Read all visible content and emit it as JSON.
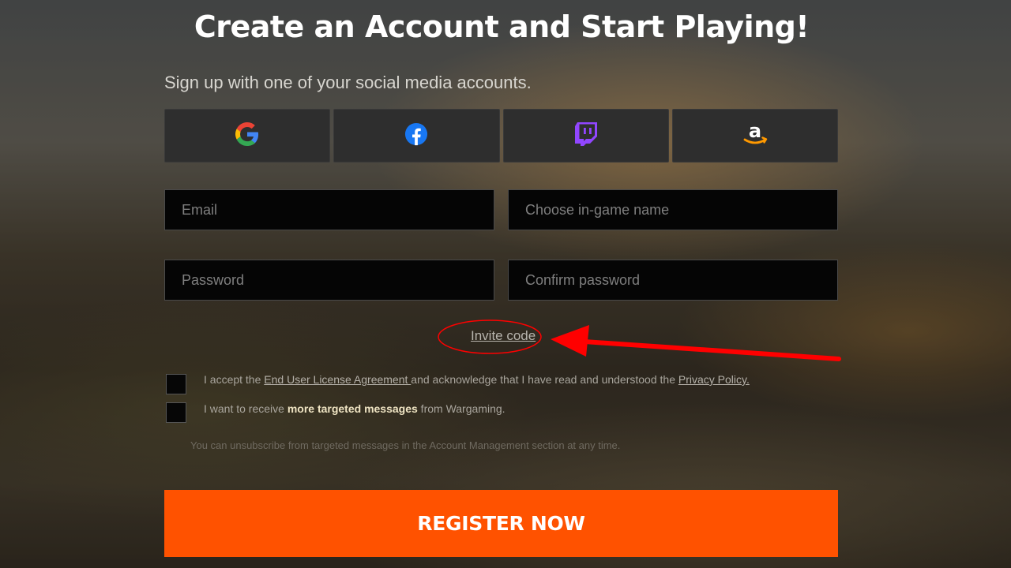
{
  "header": {
    "title": "Create an Account and Start Playing!",
    "subtitle": "Sign up with one of your social media accounts."
  },
  "social": [
    {
      "name": "google",
      "icon": "google-icon"
    },
    {
      "name": "facebook",
      "icon": "facebook-icon"
    },
    {
      "name": "twitch",
      "icon": "twitch-icon"
    },
    {
      "name": "amazon",
      "icon": "amazon-icon"
    }
  ],
  "form": {
    "email_placeholder": "Email",
    "ingame_name_placeholder": "Choose in-game name",
    "password_placeholder": "Password",
    "confirm_password_placeholder": "Confirm password",
    "invite_code": "Invite code"
  },
  "agreements": {
    "eula": {
      "prefix": "I accept the ",
      "eula_link": "End User License Agreement ",
      "middle": "and acknowledge that I have read and understood the ",
      "privacy_link": "Privacy Policy."
    },
    "marketing": {
      "prefix": "I want to receive ",
      "highlight": "more targeted messages",
      "suffix": " from Wargaming."
    },
    "unsubscribe_note": "You can unsubscribe from targeted messages in the Account Management section at any time."
  },
  "register_label": "REGISTER NOW",
  "colors": {
    "accent": "#ff5200",
    "annotation": "#ff0000",
    "input_bg": "#050505",
    "social_bg": "#2e2e2e"
  }
}
